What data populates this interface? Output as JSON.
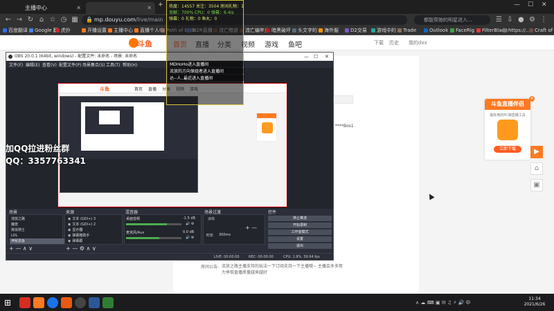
{
  "browser": {
    "tabs": [
      {
        "label": "主播中心",
        "active": false
      },
      {
        "label": "",
        "active": true
      }
    ],
    "url_host": "mp.douyu.com",
    "url_path": "/live/main",
    "search_placeholder": "都能帮她的明星进入...",
    "bookmarks": [
      {
        "label": "百度翻译",
        "color": "#2f6cf6"
      },
      {
        "label": "Google 翻",
        "color": "#4285f4"
      },
      {
        "label": "虎扑",
        "color": "#c62828"
      },
      {
        "label": "开播设置",
        "color": "#ff7a22"
      },
      {
        "label": "主播中心",
        "color": "#ff7a22"
      },
      {
        "label": "直播个人中",
        "color": "#ff7a22"
      },
      {
        "label": "Path of Exile",
        "color": "#8d6e63"
      },
      {
        "label": "D2R直播",
        "color": "#5c6bc0"
      },
      {
        "label": "流亡黯道",
        "color": "#6d4c41"
      },
      {
        "label": "流亡编年史",
        "color": "#6d4c41"
      },
      {
        "label": "暗黑破坏",
        "color": "#b71c1c"
      },
      {
        "label": "头文字的",
        "color": "#546e7a"
      },
      {
        "label": "海外服",
        "color": "#ff9800"
      },
      {
        "label": "D2交易",
        "color": "#7e57c2"
      },
      {
        "label": "游戏中的",
        "color": "#26a69a"
      },
      {
        "label": "Trade",
        "color": "#8d6e63"
      },
      {
        "label": "Outlook",
        "color": "#1565c0"
      },
      {
        "label": "FaceRig",
        "color": "#43a047"
      },
      {
        "label": "FilterBlade",
        "color": "#e53935"
      },
      {
        "label": "https://...",
        "color": "#757575"
      },
      {
        "label": "Craft of E",
        "color": "#6d4c41"
      }
    ]
  },
  "site": {
    "logo_text": "斗鱼",
    "nav": [
      "首页",
      "直播",
      "分类",
      "视频",
      "游戏",
      "鱼吧"
    ],
    "header_right": [
      "下载",
      "历史",
      "我的dxx"
    ],
    "notice_label": "房间公告:",
    "notice_text": "流放之路主播支持的玩法一下订阅支持一下主播哦~ 主播会多多努力争取直播质量越来越好",
    "side_text": "****Bos1",
    "side_card": {
      "title": "斗鱼直播伴侣",
      "subtitle": "最好用的PC端直播工具",
      "download": "立即下载"
    }
  },
  "overlay": {
    "stats": [
      "热度：14557  关注：3504  房间礼物：1",
      "贡献：700%   CPU：0     弹幕：6.4/s",
      "弹幕：0      礼物：0     鱼丸：0"
    ],
    "chat": [
      "MDHoHo进入直播间",
      "流放的方向保组者进入直播间",
      "达--人..最近进入直播间"
    ]
  },
  "watermark": {
    "line1": "加QQ拉进粉丝群",
    "line2": "QQ：3357763341"
  },
  "obs": {
    "title": "OBS 20.0.1 (64bit, windows) - 配置文件: 未命名 - 场景: 未命名",
    "menu": [
      "文件(F)",
      "编辑(E)",
      "查看(V)",
      "配置文件(P)",
      "场景集合(S)",
      "工具(T)",
      "帮助(H)"
    ],
    "docks": {
      "scenes_title": "场景",
      "sources_title": "来源",
      "mixer_title": "混音器",
      "transition_title": "场景过渡",
      "controls_title": "控件"
    },
    "scenes": [
      "流放之路",
      "魔兽",
      "炼狱骑士",
      "LOL",
      "神秘黑鱼"
    ],
    "sources": [
      "文本 (GDI+) 3",
      "文本 (GDI+) 2",
      "显示器",
      "弹幕箱助手",
      "弹幕跟"
    ],
    "mixer": [
      {
        "label": "桌面音频",
        "db": "-1.5 dB",
        "level": 0.74
      },
      {
        "label": "麦克风/Aux",
        "db": "0.0 dB",
        "level": 0.6
      }
    ],
    "transition": {
      "type": "淡出",
      "duration_label": "时长",
      "duration": "300ms"
    },
    "controls": [
      "停止推流",
      "开始录制",
      "工作室模式",
      "设置",
      "退出"
    ],
    "status": {
      "live": "LIVE: 00:00:00",
      "rec": "REC: 00:00:00",
      "cpu": "CPU: 1.9%, 59.94 fps"
    }
  },
  "taskbar": {
    "clock_time": "11:34",
    "clock_date": "2021/6/26"
  }
}
